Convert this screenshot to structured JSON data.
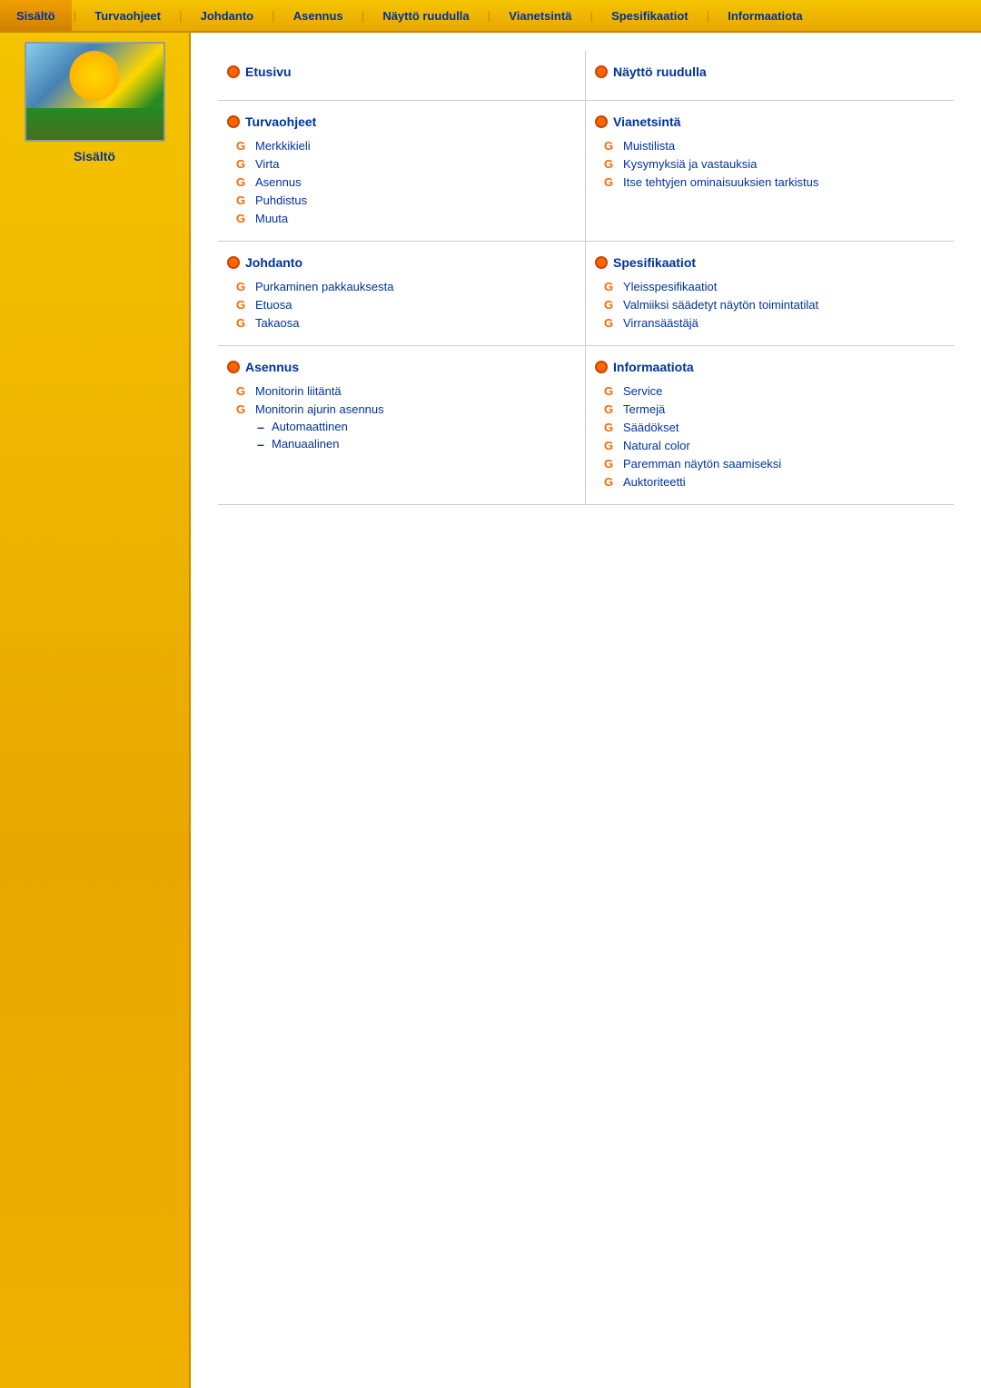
{
  "nav": {
    "items": [
      {
        "label": "Sisältö",
        "active": true
      },
      {
        "label": "Turvaohjeet",
        "active": false
      },
      {
        "label": "Johdanto",
        "active": false
      },
      {
        "label": "Asennus",
        "active": false
      },
      {
        "label": "Näyttö ruudulla",
        "active": false
      },
      {
        "label": "Vianetsintä",
        "active": false
      },
      {
        "label": "Spesifikaatiot",
        "active": false
      },
      {
        "label": "Informaatiota",
        "active": false
      }
    ]
  },
  "sidebar": {
    "title": "Sisältö"
  },
  "sections": [
    {
      "id": "etusivu",
      "title": "Etusivu",
      "type": "top",
      "items": []
    },
    {
      "id": "naytto",
      "title": "Näyttö ruudulla",
      "type": "top",
      "items": []
    },
    {
      "id": "turvaohjeet",
      "title": "Turvaohjeet",
      "type": "section",
      "items": [
        {
          "label": "Merkkikieli",
          "type": "g"
        },
        {
          "label": "Virta",
          "type": "g"
        },
        {
          "label": "Asennus",
          "type": "g"
        },
        {
          "label": "Puhdistus",
          "type": "g"
        },
        {
          "label": "Muuta",
          "type": "g"
        }
      ]
    },
    {
      "id": "vianetsinta",
      "title": "Vianetsintä",
      "type": "section",
      "items": [
        {
          "label": "Muistilista",
          "type": "g"
        },
        {
          "label": "Kysymyksiä ja vastauksia",
          "type": "g"
        },
        {
          "label": "Itse tehtyjen ominaisuuksien tarkistus",
          "type": "g"
        }
      ]
    },
    {
      "id": "johdanto",
      "title": "Johdanto",
      "type": "section",
      "items": [
        {
          "label": "Purkaminen pakkauksesta",
          "type": "g"
        },
        {
          "label": "Etuosa",
          "type": "g"
        },
        {
          "label": "Takaosa",
          "type": "g"
        }
      ]
    },
    {
      "id": "spesifikaatiot",
      "title": "Spesifikaatiot",
      "type": "section",
      "items": [
        {
          "label": "Yleisspesifikaatiot",
          "type": "g"
        },
        {
          "label": "Valmiiksi säädetyt näytön toimintatilat",
          "type": "g"
        },
        {
          "label": "Virransäästäjä",
          "type": "g"
        }
      ]
    },
    {
      "id": "asennus",
      "title": "Asennus",
      "type": "section",
      "items": [
        {
          "label": "Monitorin liitäntä",
          "type": "g"
        },
        {
          "label": "Monitorin ajurin asennus",
          "type": "g"
        },
        {
          "label": "Automaattinen",
          "type": "dash"
        },
        {
          "label": "Manuaalinen",
          "type": "dash"
        }
      ]
    },
    {
      "id": "informaatiota",
      "title": "Informaatiota",
      "type": "section",
      "items": [
        {
          "label": "Service",
          "type": "g"
        },
        {
          "label": "Termejä",
          "type": "g"
        },
        {
          "label": "Säädökset",
          "type": "g"
        },
        {
          "label": "Natural color",
          "type": "g"
        },
        {
          "label": "Paremman näytön saamiseksi",
          "type": "g"
        },
        {
          "label": "Auktoriteetti",
          "type": "g"
        }
      ]
    }
  ]
}
